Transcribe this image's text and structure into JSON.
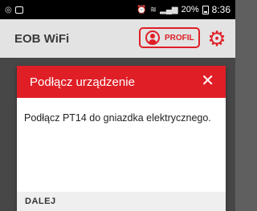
{
  "status_bar": {
    "time": "8:36",
    "battery": "20%",
    "icons": [
      "whatsapp-icon",
      "gallery-icon",
      "alarm-icon",
      "wifi-icon",
      "signal-icon",
      "battery-icon"
    ]
  },
  "app_bar": {
    "title": "EOB WiFi",
    "profile_label": "PROFIL",
    "accent": "#e01e26"
  },
  "dialog": {
    "title": "Podłącz urządzenie",
    "message": "Podłącz PT14 do gniazdka elektrycznego.",
    "next_label": "DALEJ"
  }
}
